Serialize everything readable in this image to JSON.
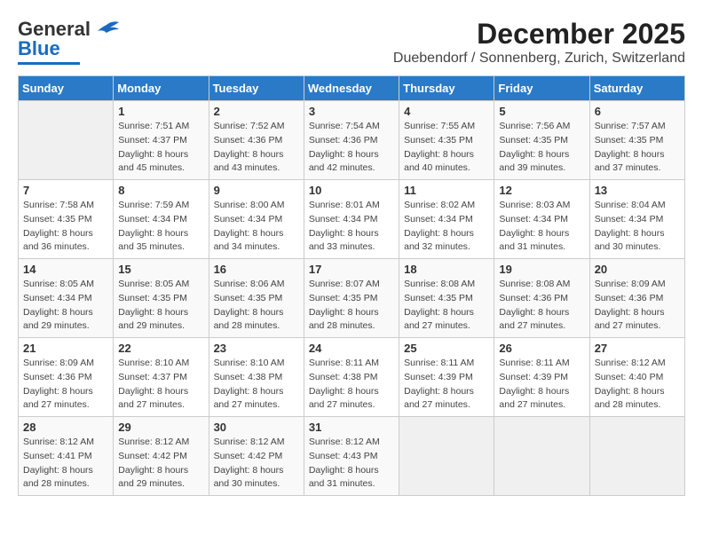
{
  "header": {
    "logo": {
      "line1": "General",
      "line2": "Blue"
    },
    "title": "December 2025",
    "subtitle": "Duebendorf / Sonnenberg, Zurich, Switzerland"
  },
  "calendar": {
    "weekdays": [
      "Sunday",
      "Monday",
      "Tuesday",
      "Wednesday",
      "Thursday",
      "Friday",
      "Saturday"
    ],
    "weeks": [
      [
        {
          "day": "",
          "info": ""
        },
        {
          "day": "1",
          "info": "Sunrise: 7:51 AM\nSunset: 4:37 PM\nDaylight: 8 hours\nand 45 minutes."
        },
        {
          "day": "2",
          "info": "Sunrise: 7:52 AM\nSunset: 4:36 PM\nDaylight: 8 hours\nand 43 minutes."
        },
        {
          "day": "3",
          "info": "Sunrise: 7:54 AM\nSunset: 4:36 PM\nDaylight: 8 hours\nand 42 minutes."
        },
        {
          "day": "4",
          "info": "Sunrise: 7:55 AM\nSunset: 4:35 PM\nDaylight: 8 hours\nand 40 minutes."
        },
        {
          "day": "5",
          "info": "Sunrise: 7:56 AM\nSunset: 4:35 PM\nDaylight: 8 hours\nand 39 minutes."
        },
        {
          "day": "6",
          "info": "Sunrise: 7:57 AM\nSunset: 4:35 PM\nDaylight: 8 hours\nand 37 minutes."
        }
      ],
      [
        {
          "day": "7",
          "info": "Sunrise: 7:58 AM\nSunset: 4:35 PM\nDaylight: 8 hours\nand 36 minutes."
        },
        {
          "day": "8",
          "info": "Sunrise: 7:59 AM\nSunset: 4:34 PM\nDaylight: 8 hours\nand 35 minutes."
        },
        {
          "day": "9",
          "info": "Sunrise: 8:00 AM\nSunset: 4:34 PM\nDaylight: 8 hours\nand 34 minutes."
        },
        {
          "day": "10",
          "info": "Sunrise: 8:01 AM\nSunset: 4:34 PM\nDaylight: 8 hours\nand 33 minutes."
        },
        {
          "day": "11",
          "info": "Sunrise: 8:02 AM\nSunset: 4:34 PM\nDaylight: 8 hours\nand 32 minutes."
        },
        {
          "day": "12",
          "info": "Sunrise: 8:03 AM\nSunset: 4:34 PM\nDaylight: 8 hours\nand 31 minutes."
        },
        {
          "day": "13",
          "info": "Sunrise: 8:04 AM\nSunset: 4:34 PM\nDaylight: 8 hours\nand 30 minutes."
        }
      ],
      [
        {
          "day": "14",
          "info": "Sunrise: 8:05 AM\nSunset: 4:34 PM\nDaylight: 8 hours\nand 29 minutes."
        },
        {
          "day": "15",
          "info": "Sunrise: 8:05 AM\nSunset: 4:35 PM\nDaylight: 8 hours\nand 29 minutes."
        },
        {
          "day": "16",
          "info": "Sunrise: 8:06 AM\nSunset: 4:35 PM\nDaylight: 8 hours\nand 28 minutes."
        },
        {
          "day": "17",
          "info": "Sunrise: 8:07 AM\nSunset: 4:35 PM\nDaylight: 8 hours\nand 28 minutes."
        },
        {
          "day": "18",
          "info": "Sunrise: 8:08 AM\nSunset: 4:35 PM\nDaylight: 8 hours\nand 27 minutes."
        },
        {
          "day": "19",
          "info": "Sunrise: 8:08 AM\nSunset: 4:36 PM\nDaylight: 8 hours\nand 27 minutes."
        },
        {
          "day": "20",
          "info": "Sunrise: 8:09 AM\nSunset: 4:36 PM\nDaylight: 8 hours\nand 27 minutes."
        }
      ],
      [
        {
          "day": "21",
          "info": "Sunrise: 8:09 AM\nSunset: 4:36 PM\nDaylight: 8 hours\nand 27 minutes."
        },
        {
          "day": "22",
          "info": "Sunrise: 8:10 AM\nSunset: 4:37 PM\nDaylight: 8 hours\nand 27 minutes."
        },
        {
          "day": "23",
          "info": "Sunrise: 8:10 AM\nSunset: 4:38 PM\nDaylight: 8 hours\nand 27 minutes."
        },
        {
          "day": "24",
          "info": "Sunrise: 8:11 AM\nSunset: 4:38 PM\nDaylight: 8 hours\nand 27 minutes."
        },
        {
          "day": "25",
          "info": "Sunrise: 8:11 AM\nSunset: 4:39 PM\nDaylight: 8 hours\nand 27 minutes."
        },
        {
          "day": "26",
          "info": "Sunrise: 8:11 AM\nSunset: 4:39 PM\nDaylight: 8 hours\nand 27 minutes."
        },
        {
          "day": "27",
          "info": "Sunrise: 8:12 AM\nSunset: 4:40 PM\nDaylight: 8 hours\nand 28 minutes."
        }
      ],
      [
        {
          "day": "28",
          "info": "Sunrise: 8:12 AM\nSunset: 4:41 PM\nDaylight: 8 hours\nand 28 minutes."
        },
        {
          "day": "29",
          "info": "Sunrise: 8:12 AM\nSunset: 4:42 PM\nDaylight: 8 hours\nand 29 minutes."
        },
        {
          "day": "30",
          "info": "Sunrise: 8:12 AM\nSunset: 4:42 PM\nDaylight: 8 hours\nand 30 minutes."
        },
        {
          "day": "31",
          "info": "Sunrise: 8:12 AM\nSunset: 4:43 PM\nDaylight: 8 hours\nand 31 minutes."
        },
        {
          "day": "",
          "info": ""
        },
        {
          "day": "",
          "info": ""
        },
        {
          "day": "",
          "info": ""
        }
      ]
    ]
  }
}
